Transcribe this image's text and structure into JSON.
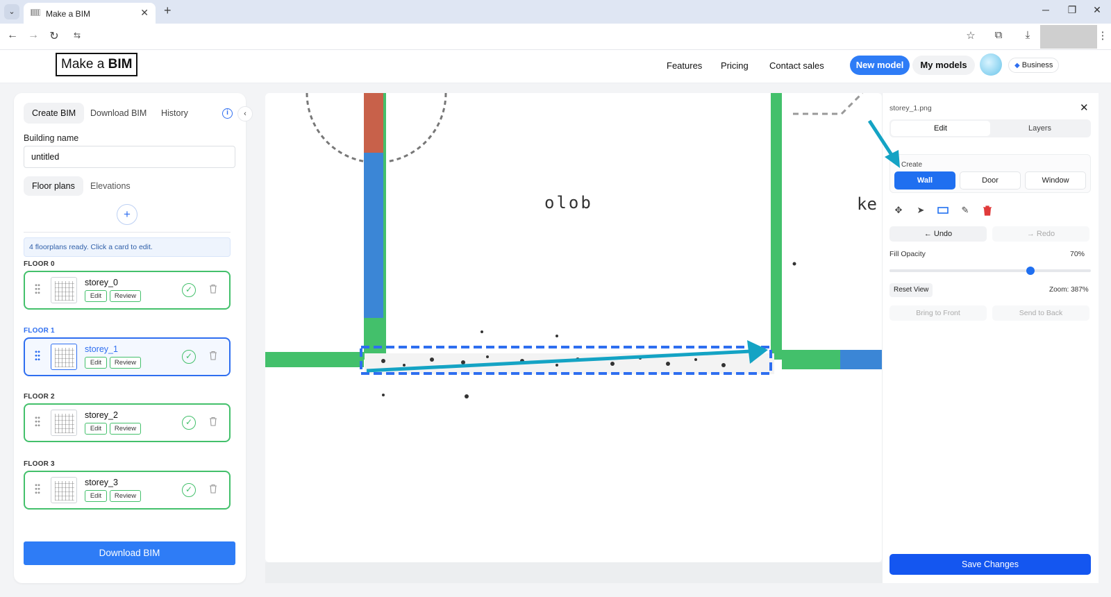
{
  "browser": {
    "tab_title": "Make a BIM",
    "tab_close": "✕",
    "new_tab": "+",
    "tab_menu": "⌄",
    "site_info": "⇆"
  },
  "header": {
    "logo_prefix": "Make a ",
    "logo_bold": "BIM",
    "nav": [
      "Features",
      "Pricing",
      "Contact sales"
    ],
    "new_model": "New model",
    "my_models": "My models",
    "business_badge": "Business"
  },
  "left_panel": {
    "tabs": [
      "Create BIM",
      "Download BIM",
      "History"
    ],
    "active_tab": "Create BIM",
    "building_name_label": "Building name",
    "building_name_value": "untitled",
    "sub_tabs": [
      "Floor plans",
      "Elevations"
    ],
    "add_label": "+",
    "status_note": "4 floorplans ready. Click a card to edit.",
    "floors": [
      {
        "label": "FLOOR 0",
        "name": "storey_0",
        "edit": "Edit",
        "review": "Review",
        "selected": false
      },
      {
        "label": "FLOOR 1",
        "name": "storey_1",
        "edit": "Edit",
        "review": "Review",
        "selected": true
      },
      {
        "label": "FLOOR 2",
        "name": "storey_2",
        "edit": "Edit",
        "review": "Review",
        "selected": false
      },
      {
        "label": "FLOOR 3",
        "name": "storey_3",
        "edit": "Edit",
        "review": "Review",
        "selected": false
      }
    ],
    "download_button": "Download BIM"
  },
  "canvas": {
    "room_label": "olob",
    "partial_label": "ke"
  },
  "right_panel": {
    "file_name": "storey_1.png",
    "tabs": [
      "Edit",
      "Layers"
    ],
    "create_label": "Create",
    "create_buttons": [
      "Wall",
      "Door",
      "Window"
    ],
    "active_create": "Wall",
    "undo": "← Undo",
    "redo": "→ Redo",
    "fill_opacity_label": "Fill Opacity",
    "fill_opacity_value": "70%",
    "fill_opacity": 0.7,
    "reset_view": "Reset View",
    "zoom": "Zoom: 387%",
    "bring_to_front": "Bring to Front",
    "send_to_back": "Send to Back",
    "save_button": "Save Changes"
  },
  "colors": {
    "primary": "#2e7cf6",
    "save": "#1456f0",
    "wall_green": "#43c06b",
    "wall_blue": "#3b86d6",
    "wall_red": "#c8614a",
    "annotation_teal": "#14a3c4"
  }
}
